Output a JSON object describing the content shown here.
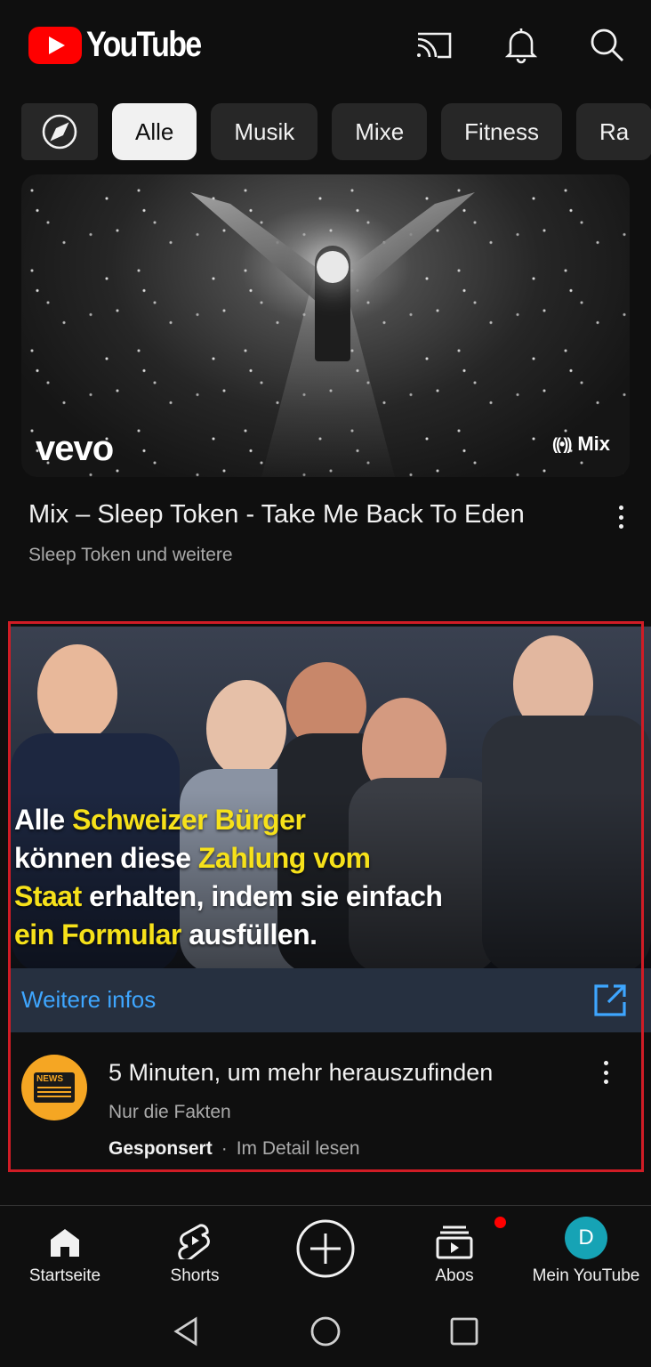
{
  "header": {
    "logo_text": "YouTube",
    "icons": [
      "cast-icon",
      "bell-icon",
      "search-icon"
    ]
  },
  "chips": {
    "explore_icon": "compass-icon",
    "items": [
      "Alle",
      "Musik",
      "Mixe",
      "Fitness",
      "Ra"
    ],
    "active": "Alle"
  },
  "video": {
    "thumbnail_watermark": "vevo",
    "badge": "Mix",
    "title": "Mix – Sleep Token - Take Me Back To Eden",
    "subtitle": "Sleep Token und weitere"
  },
  "ad": {
    "headline": {
      "w1": "Alle ",
      "hl1": "Schweizer Bürger",
      "w2": "können diese ",
      "hl2": "Zahlung vom",
      "hl3": "Staat",
      "w3": " erhalten, indem sie einfach",
      "hl4": "ein Formular",
      "w4": " ausfüllen."
    },
    "more_info": "Weitere infos",
    "title": "5 Minuten, um mehr herauszufinden",
    "channel": "Nur die Fakten",
    "sponsored": "Gesponsert",
    "separator": "·",
    "read_more": "Im Detail lesen",
    "highlight_color": "#d01c25"
  },
  "bottom_nav": {
    "items": [
      {
        "label": "Startseite",
        "icon": "home-icon"
      },
      {
        "label": "Shorts",
        "icon": "shorts-icon"
      },
      {
        "label": "",
        "icon": "create-icon"
      },
      {
        "label": "Abos",
        "icon": "subscriptions-icon"
      },
      {
        "label": "Mein YouTube",
        "icon": "avatar"
      }
    ],
    "avatar_letter": "D"
  },
  "colors": {
    "background": "#0f0f0f",
    "brand_red": "#ff0000",
    "link_blue": "#3ea6ff",
    "headline_yellow": "#f6e11a"
  }
}
